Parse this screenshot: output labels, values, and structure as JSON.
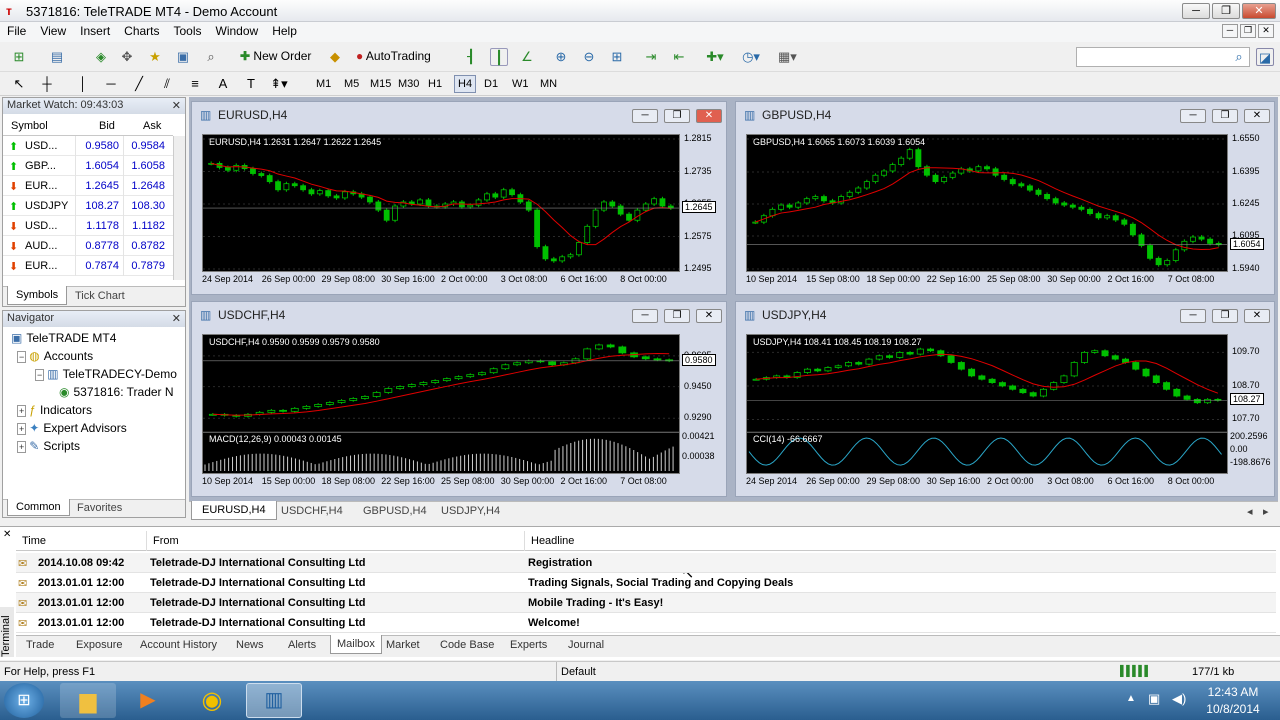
{
  "window": {
    "title": "5371816: TeleTRADE MT4 - Demo Account",
    "min": "─",
    "max": "❐",
    "close": "✕"
  },
  "menu": [
    "File",
    "View",
    "Insert",
    "Charts",
    "Tools",
    "Window",
    "Help"
  ],
  "toolbar": {
    "new_order": "New Order",
    "autotrading": "AutoTrading",
    "search_placeholder": ""
  },
  "timeframes": [
    "M1",
    "M5",
    "M15",
    "M30",
    "H1",
    "H4",
    "D1",
    "W1",
    "MN"
  ],
  "active_timeframe": "H4",
  "market_watch": {
    "title": "Market Watch: 09:43:03",
    "headers": [
      "Symbol",
      "Bid",
      "Ask"
    ],
    "rows": [
      {
        "symbol": "USD...",
        "bid": "0.9580",
        "ask": "0.9584",
        "dir": "up"
      },
      {
        "symbol": "GBP...",
        "bid": "1.6054",
        "ask": "1.6058",
        "dir": "up"
      },
      {
        "symbol": "EUR...",
        "bid": "1.2645",
        "ask": "1.2648",
        "dir": "down"
      },
      {
        "symbol": "USDJPY",
        "bid": "108.27",
        "ask": "108.30",
        "dir": "up"
      },
      {
        "symbol": "USD...",
        "bid": "1.1178",
        "ask": "1.1182",
        "dir": "down"
      },
      {
        "symbol": "AUD...",
        "bid": "0.8778",
        "ask": "0.8782",
        "dir": "down"
      },
      {
        "symbol": "EUR...",
        "bid": "0.7874",
        "ask": "0.7879",
        "dir": "down"
      }
    ],
    "tabs": [
      "Symbols",
      "Tick Chart"
    ]
  },
  "navigator": {
    "title": "Navigator",
    "items": [
      {
        "label": "TeleTRADE MT4",
        "level": 0
      },
      {
        "label": "Accounts",
        "level": 1
      },
      {
        "label": "TeleTRADECY-Demo",
        "level": 2
      },
      {
        "label": "5371816: Trader N",
        "level": 3
      },
      {
        "label": "Indicators",
        "level": 1
      },
      {
        "label": "Expert Advisors",
        "level": 1
      },
      {
        "label": "Scripts",
        "level": 1
      }
    ],
    "tabs": [
      "Common",
      "Favorites"
    ]
  },
  "charts": [
    {
      "id": "eurusd",
      "title": "EURUSD,H4",
      "legend": "EURUSD,H4  1.2631 1.2647 1.2622 1.2645",
      "price": "1.2645",
      "yticks": [
        "1.2815",
        "1.2735",
        "1.2655",
        "1.2575",
        "1.2495"
      ],
      "xticks": [
        "24 Sep 2014",
        "26 Sep 00:00",
        "29 Sep 08:00",
        "30 Sep 16:00",
        "2 Oct 00:00",
        "3 Oct 08:00",
        "6 Oct 16:00",
        "8 Oct 00:00"
      ],
      "closes": [
        1.2755,
        1.2745,
        1.2738,
        1.275,
        1.2742,
        1.273,
        1.2725,
        1.271,
        1.269,
        1.2705,
        1.27,
        1.269,
        1.268,
        1.2688,
        1.2675,
        1.267,
        1.2685,
        1.268,
        1.2672,
        1.266,
        1.264,
        1.2615,
        1.265,
        1.266,
        1.2655,
        1.2665,
        1.265,
        1.2648,
        1.2655,
        1.266,
        1.2648,
        1.2652,
        1.2665,
        1.268,
        1.2672,
        1.269,
        1.2678,
        1.266,
        1.264,
        1.255,
        1.252,
        1.2515,
        1.2525,
        1.253,
        1.256,
        1.26,
        1.264,
        1.266,
        1.265,
        1.263,
        1.2615,
        1.264,
        1.2655,
        1.2668,
        1.265,
        1.2645
      ],
      "ylim": [
        1.2495,
        1.2815
      ]
    },
    {
      "id": "gbpusd",
      "title": "GBPUSD,H4",
      "legend": "GBPUSD,H4  1.6065 1.6073 1.6039 1.6054",
      "price": "1.6054",
      "yticks": [
        "1.6550",
        "1.6395",
        "1.6245",
        "1.6095",
        "1.5940"
      ],
      "xticks": [
        "10 Sep 2014",
        "15 Sep 08:00",
        "18 Sep 00:00",
        "22 Sep 16:00",
        "25 Sep 08:00",
        "30 Sep 00:00",
        "2 Oct 16:00",
        "7 Oct 08:00"
      ],
      "closes": [
        1.616,
        1.619,
        1.622,
        1.624,
        1.623,
        1.625,
        1.627,
        1.628,
        1.626,
        1.625,
        1.628,
        1.63,
        1.632,
        1.635,
        1.638,
        1.64,
        1.643,
        1.646,
        1.65,
        1.642,
        1.638,
        1.635,
        1.637,
        1.639,
        1.641,
        1.64,
        1.642,
        1.641,
        1.638,
        1.636,
        1.634,
        1.633,
        1.631,
        1.629,
        1.627,
        1.625,
        1.624,
        1.623,
        1.622,
        1.62,
        1.618,
        1.619,
        1.617,
        1.615,
        1.61,
        1.605,
        1.599,
        1.596,
        1.598,
        1.603,
        1.607,
        1.609,
        1.608,
        1.606,
        1.6054
      ],
      "ylim": [
        1.594,
        1.655
      ]
    },
    {
      "id": "usdchf",
      "title": "USDCHF,H4",
      "legend": "USDCHF,H4  0.9590 0.9599 0.9579 0.9580",
      "price": "0.9580",
      "yticks": [
        "0.9605",
        "0.9450",
        "0.9290"
      ],
      "xticks": [
        "10 Sep 2014",
        "15 Sep 00:00",
        "18 Sep 08:00",
        "22 Sep 16:00",
        "25 Sep 08:00",
        "30 Sep 00:00",
        "2 Oct 16:00",
        "7 Oct 08:00"
      ],
      "closes": [
        0.931,
        0.9305,
        0.93,
        0.931,
        0.932,
        0.933,
        0.9325,
        0.934,
        0.935,
        0.936,
        0.937,
        0.938,
        0.939,
        0.94,
        0.942,
        0.944,
        0.945,
        0.946,
        0.947,
        0.948,
        0.949,
        0.95,
        0.951,
        0.952,
        0.954,
        0.956,
        0.957,
        0.958,
        0.9575,
        0.956,
        0.957,
        0.959,
        0.964,
        0.966,
        0.965,
        0.962,
        0.96,
        0.959,
        0.9585,
        0.958
      ],
      "ylim": [
        0.925,
        0.969
      ],
      "indicator": {
        "legend": "MACD(12,26,9) 0.00043 0.00145",
        "ticks": [
          "0.00421",
          "0.00038"
        ]
      }
    },
    {
      "id": "usdjpy",
      "title": "USDJPY,H4",
      "legend": "USDJPY,H4  108.41 108.45 108.19 108.27",
      "price": "108.27",
      "yticks": [
        "109.70",
        "108.70",
        "107.70"
      ],
      "xticks": [
        "24 Sep 2014",
        "26 Sep 00:00",
        "29 Sep 08:00",
        "30 Sep 16:00",
        "2 Oct 00:00",
        "3 Oct 08:00",
        "6 Oct 16:00",
        "8 Oct 00:00"
      ],
      "closes": [
        108.9,
        108.95,
        109.0,
        108.95,
        109.1,
        109.2,
        109.15,
        109.25,
        109.3,
        109.4,
        109.35,
        109.5,
        109.6,
        109.55,
        109.7,
        109.65,
        109.8,
        109.75,
        109.6,
        109.4,
        109.2,
        109.0,
        108.9,
        108.8,
        108.7,
        108.6,
        108.5,
        108.4,
        108.6,
        108.8,
        109.0,
        109.4,
        109.7,
        109.75,
        109.6,
        109.5,
        109.4,
        109.2,
        109.0,
        108.8,
        108.6,
        108.4,
        108.3,
        108.2,
        108.3,
        108.27
      ],
      "ylim": [
        107.5,
        110.1
      ],
      "indicator": {
        "legend": "CCI(14) -66.6667",
        "ticks": [
          "200.2596",
          "0.00",
          "-198.8676"
        ]
      }
    }
  ],
  "chart_tabs": [
    "EURUSD,H4",
    "USDCHF,H4",
    "GBPUSD,H4",
    "USDJPY,H4"
  ],
  "terminal": {
    "label": "Terminal",
    "headers": [
      "Time",
      "From",
      "Headline"
    ],
    "rows": [
      {
        "time": "2014.10.08 09:42",
        "from": "Teletrade-DJ International Consulting Ltd",
        "headline": "Registration"
      },
      {
        "time": "2013.01.01 12:00",
        "from": "Teletrade-DJ International Consulting Ltd",
        "headline": "Trading Signals, Social Trading and Copying Deals"
      },
      {
        "time": "2013.01.01 12:00",
        "from": "Teletrade-DJ International Consulting Ltd",
        "headline": "Mobile Trading - It's Easy!"
      },
      {
        "time": "2013.01.01 12:00",
        "from": "Teletrade-DJ International Consulting Ltd",
        "headline": "Welcome!"
      }
    ],
    "tabs": [
      "Trade",
      "Exposure",
      "Account History",
      "News",
      "Alerts",
      "Mailbox",
      "Market",
      "Code Base",
      "Experts",
      "Journal"
    ],
    "active_tab": "Mailbox"
  },
  "status": {
    "help": "For Help, press F1",
    "profile": "Default",
    "traffic": "177/1 kb"
  },
  "taskbar": {
    "time": "12:43 AM",
    "date": "10/8/2014"
  },
  "colors": {
    "up": "#00c000",
    "down": "#e04000",
    "ma": "#e00000",
    "grid": "#2a2a2a"
  }
}
